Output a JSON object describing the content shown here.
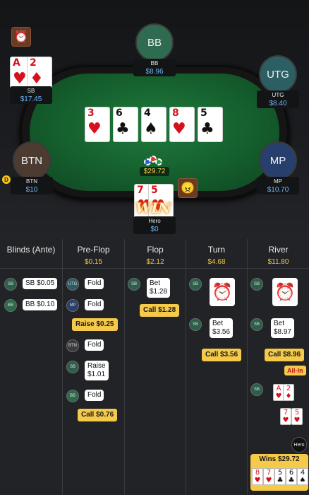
{
  "table": {
    "seats": [
      {
        "id": "bb",
        "avatar": "BB",
        "name": "BB",
        "stack": "$8.96"
      },
      {
        "id": "utg",
        "avatar": "UTG",
        "name": "UTG",
        "stack": "$8.40"
      },
      {
        "id": "mp",
        "avatar": "MP",
        "name": "MP",
        "stack": "$10.70"
      },
      {
        "id": "btn",
        "avatar": "BTN",
        "name": "BTN",
        "stack": "$10"
      },
      {
        "id": "sb",
        "name": "SB",
        "stack": "$17.45"
      },
      {
        "id": "hero",
        "name": "Hero",
        "stack": "$0"
      }
    ],
    "sb_hole_cards": [
      {
        "rank": "A",
        "suit": "♥"
      },
      {
        "rank": "2",
        "suit": "♦"
      }
    ],
    "hero_hole_cards": [
      {
        "rank": "7",
        "suit": "♥"
      },
      {
        "rank": "5",
        "suit": "♥"
      }
    ],
    "board": [
      {
        "rank": "3",
        "suit": "♥",
        "color": "red"
      },
      {
        "rank": "6",
        "suit": "♣",
        "color": "black"
      },
      {
        "rank": "4",
        "suit": "♠",
        "color": "black"
      },
      {
        "rank": "8",
        "suit": "♥",
        "color": "red"
      },
      {
        "rank": "5",
        "suit": "♣",
        "color": "black"
      }
    ],
    "pot": "$29.72",
    "win_badge": "WIN",
    "dealer_button": "D"
  },
  "log": {
    "columns": [
      {
        "title": "Blinds (Ante)",
        "sub": ""
      },
      {
        "title": "Pre-Flop",
        "sub": "$0.15"
      },
      {
        "title": "Flop",
        "sub": "$2.12"
      },
      {
        "title": "Turn",
        "sub": "$4.68"
      },
      {
        "title": "River",
        "sub": "$11.80"
      }
    ],
    "blinds": [
      {
        "pos": "SB",
        "action": "SB $0.05"
      },
      {
        "pos": "BB",
        "action": "BB $0.10"
      }
    ],
    "preflop": [
      {
        "pos": "UTG",
        "action": "Fold"
      },
      {
        "pos": "MP",
        "action": "Fold"
      },
      {
        "hero_action": "Raise $0.25"
      },
      {
        "pos": "BTN",
        "action": "Fold"
      },
      {
        "pos": "SB",
        "action_l1": "Raise",
        "action_l2": "$1.01"
      },
      {
        "pos": "BB",
        "action": "Fold"
      },
      {
        "hero_action": "Call $0.76"
      }
    ],
    "flop": [
      {
        "pos": "SB",
        "action_l1": "Bet",
        "action_l2": "$1.28"
      },
      {
        "hero_action": "Call $1.28"
      }
    ],
    "turn": [
      {
        "pos": "SB",
        "icon": "alarm-clock-icon"
      },
      {
        "pos": "SB",
        "action_l1": "Bet",
        "action_l2": "$3.56"
      },
      {
        "hero_action": "Call $3.56"
      }
    ],
    "river": [
      {
        "pos": "SB",
        "icon": "alarm-clock-icon"
      },
      {
        "pos": "SB",
        "action_l1": "Bet",
        "action_l2": "$8.97"
      },
      {
        "hero_action": "Call $8.96"
      },
      {
        "tag": "All-In"
      },
      {
        "pos": "SB",
        "shows": [
          {
            "rank": "A",
            "suit": "♥"
          },
          {
            "rank": "2",
            "suit": "♦"
          }
        ]
      },
      {
        "hero_shows": [
          {
            "rank": "7",
            "suit": "♥"
          },
          {
            "rank": "5",
            "suit": "♥"
          }
        ]
      },
      {
        "hero_tag": "Hero",
        "wins": "Wins $29.72"
      }
    ],
    "winning_hand": [
      {
        "rank": "8",
        "suit": "♥"
      },
      {
        "rank": "7",
        "suit": "♥"
      },
      {
        "rank": "5",
        "suit": "♣"
      },
      {
        "rank": "6",
        "suit": "♣"
      },
      {
        "rank": "4",
        "suit": "♠"
      }
    ]
  },
  "colors": {
    "felt": "#1f7a3c",
    "stack_text": "#6fb7f4",
    "highlight": "#f5c94a",
    "pot_text": "#f7d34a"
  }
}
